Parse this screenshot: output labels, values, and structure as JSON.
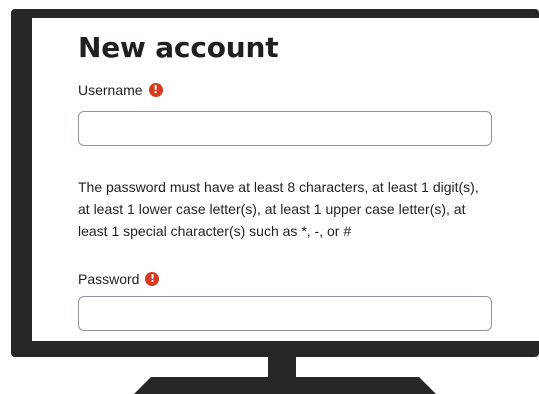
{
  "form": {
    "title": "New account",
    "username": {
      "label": "Username",
      "required_icon": "!",
      "value": ""
    },
    "password_rules": "The password must have at least 8 characters, at least 1 digit(s), at least 1 lower case letter(s), at least 1 upper case letter(s), at least 1 special character(s) such as *, -, or #",
    "password": {
      "label": "Password",
      "required_icon": "!",
      "value": ""
    }
  },
  "colors": {
    "monitor": "#262626",
    "required": "#d63a21",
    "text": "#1d2125",
    "input_border": "#8f959e"
  },
  "icons": {
    "required": "exclamation-circle-icon"
  }
}
